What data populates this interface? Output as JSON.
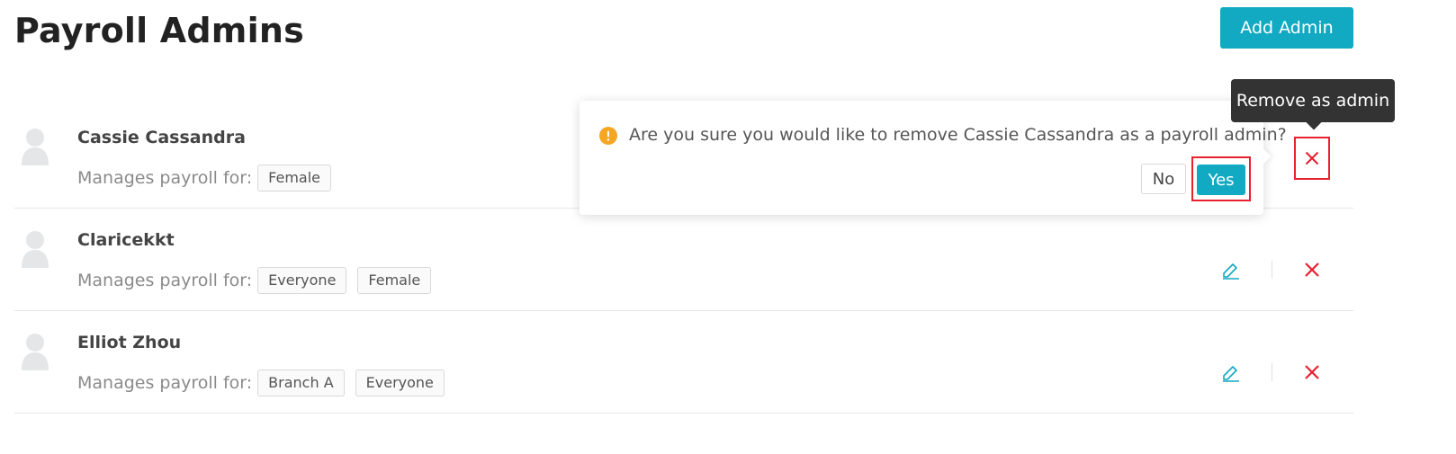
{
  "page": {
    "title": "Payroll Admins",
    "add_button_label": "Add Admin"
  },
  "admins": [
    {
      "name": "Cassie Cassandra",
      "manages_label": "Manages payroll for:",
      "groups": [
        "Female"
      ]
    },
    {
      "name": "Claricekkt",
      "manages_label": "Manages payroll for:",
      "groups": [
        "Everyone",
        "Female"
      ]
    },
    {
      "name": "Elliot Zhou",
      "manages_label": "Manages payroll for:",
      "groups": [
        "Branch A",
        "Everyone"
      ]
    }
  ],
  "popconfirm": {
    "message": "Are you sure you would like to remove Cassie Cassandra as a payroll admin?",
    "no_label": "No",
    "yes_label": "Yes"
  },
  "tooltip": {
    "text": "Remove as admin"
  },
  "icons": {
    "avatar": "user-silhouette-icon",
    "edit": "pencil-icon",
    "remove": "close-icon",
    "warning": "exclamation-circle-icon"
  },
  "colors": {
    "accent": "#12a9c2",
    "danger": "#e8202f",
    "warning": "#f5a623",
    "tooltip_bg": "#333333"
  }
}
